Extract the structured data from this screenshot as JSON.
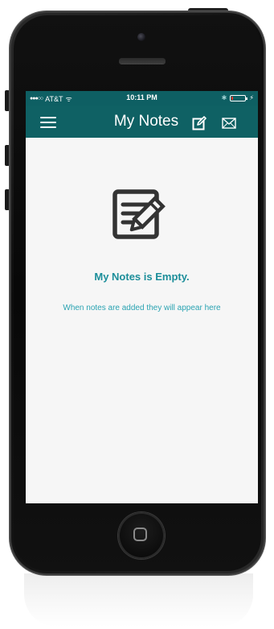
{
  "status_bar": {
    "signal": "●●●○○",
    "carrier": "AT&T",
    "wifi_symbol": "ᯤ",
    "time": "10:11 PM",
    "bluetooth_symbol": "✱",
    "charging_symbol": "⚡",
    "battery_level_percent": 15,
    "battery_color": "#e8352b"
  },
  "nav": {
    "title": "My Notes",
    "menu_icon": "hamburger-menu-icon",
    "compose_icon": "edit-icon",
    "mail_icon": "mail-icon",
    "background_color": "#0f6164"
  },
  "empty_state": {
    "icon": "notes-edit-icon",
    "title": "My Notes is Empty.",
    "subtitle": "When notes are added they will appear here",
    "accent_color": "#1c8e9a"
  }
}
